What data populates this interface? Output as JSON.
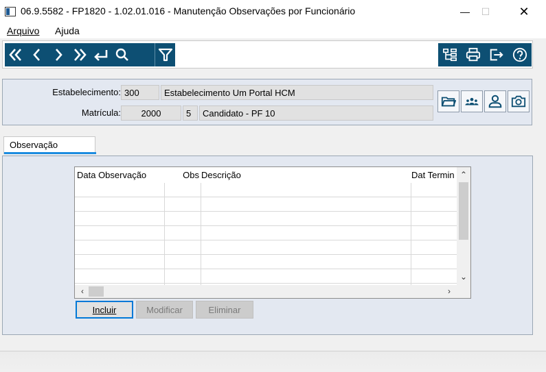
{
  "window": {
    "title": "06.9.5582 - FP1820 - 1.02.01.016 - Manutenção Observações por Funcionário",
    "minimize": "—",
    "maximize": "☐",
    "close": "✕"
  },
  "menu": {
    "arquivo": "Arquivo",
    "ajuda": "Ajuda"
  },
  "toolbar": {
    "nav_icons": [
      "first-record-icon",
      "previous-record-icon",
      "next-record-icon",
      "last-record-icon",
      "goto-icon",
      "search-icon",
      "filter-icon"
    ],
    "right_icons": [
      "hierarchy-icon",
      "print-icon",
      "exit-icon",
      "help-icon"
    ],
    "toolbar_color": "#0d4f73"
  },
  "header": {
    "estabelecimento_label": "Estabelecimento:",
    "estabelecimento_code": "300",
    "estabelecimento_name": "Estabelecimento Um Portal HCM",
    "matricula_label": "Matrícula:",
    "matricula_code": "2000",
    "matricula_digit": "5",
    "matricula_name": "Candidato -  PF 10",
    "side_icons": [
      "folder-icon",
      "group-icon",
      "person-icon",
      "camera-icon"
    ]
  },
  "tab": {
    "label": "Observação",
    "accent": "#1c8ce0"
  },
  "table": {
    "columns": [
      "Data Observação",
      "Obs",
      "Descrição",
      "Dat Termin"
    ],
    "rows": [
      [
        "",
        "",
        "",
        ""
      ],
      [
        "",
        "",
        "",
        ""
      ],
      [
        "",
        "",
        "",
        ""
      ],
      [
        "",
        "",
        "",
        ""
      ],
      [
        "",
        "",
        "",
        ""
      ],
      [
        "",
        "",
        "",
        ""
      ],
      [
        "",
        "",
        "",
        ""
      ]
    ]
  },
  "buttons": {
    "incluir": "Incluir",
    "modificar": "Modificar",
    "eliminar": "Eliminar"
  }
}
